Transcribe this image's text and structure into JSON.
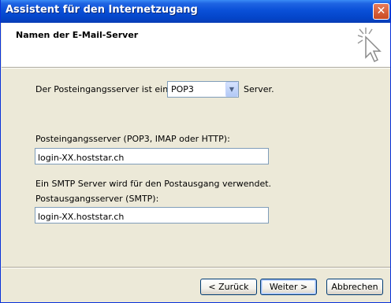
{
  "window": {
    "title": "Assistent für den Internetzugang",
    "close_glyph": "✕"
  },
  "header": {
    "title": "Namen der E-Mail-Server",
    "icon": "wizard-cursor-icon"
  },
  "form": {
    "incoming_type_prefix": "Der Posteingangsserver ist ein",
    "incoming_type_value": "POP3",
    "incoming_type_suffix": "Server.",
    "incoming_label": "Posteingangsserver (POP3, IMAP oder HTTP):",
    "incoming_value": "login-XX.hoststar.ch",
    "smtp_note": "Ein SMTP Server wird für den Postausgang verwendet.",
    "outgoing_label": "Postausgangsserver (SMTP):",
    "outgoing_value": "login-XX.hoststar.ch"
  },
  "buttons": {
    "back": "< Zurück",
    "next": "Weiter >",
    "cancel": "Abbrechen"
  },
  "colors": {
    "titlebar": "#0A50D8",
    "dialog_bg": "#ECE9D8",
    "input_border": "#7F9DB9"
  }
}
